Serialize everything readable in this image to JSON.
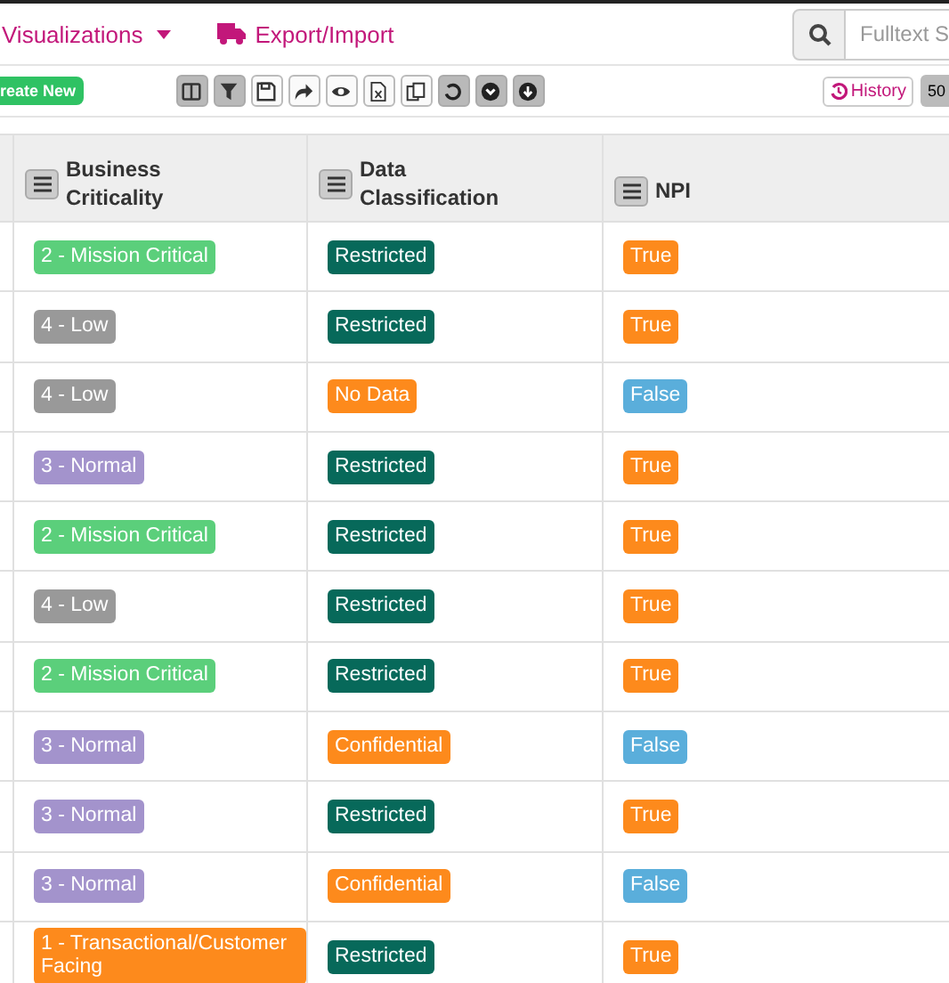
{
  "nav": {
    "visualizations": "Visualizations",
    "export": "Export/Import",
    "search": {
      "placeholder": "Fulltext S"
    }
  },
  "toolbar": {
    "create": "reate New",
    "buttons": [
      {
        "active": true
      },
      {
        "active": true
      },
      {
        "active": false
      },
      {
        "active": false
      },
      {
        "active": false
      },
      {
        "active": false
      },
      {
        "active": false
      },
      {
        "active": true
      },
      {
        "active": true
      },
      {
        "active": true
      }
    ],
    "history": "History",
    "page_size": "50"
  },
  "table": {
    "columns": [
      "Business Criticality",
      "Data Classification",
      "NPI"
    ],
    "rows": [
      [
        {
          "text": "2 - Mission Critical",
          "color": "#5bcf7b"
        },
        {
          "text": "Restricted",
          "color": "#07695a"
        },
        {
          "text": "True",
          "color": "#fd8a1c"
        }
      ],
      [
        {
          "text": "4 - Low",
          "color": "#999999"
        },
        {
          "text": "Restricted",
          "color": "#07695a"
        },
        {
          "text": "True",
          "color": "#fd8a1c"
        }
      ],
      [
        {
          "text": "4 - Low",
          "color": "#999999"
        },
        {
          "text": "No Data",
          "color": "#fd8a1c"
        },
        {
          "text": "False",
          "color": "#5aaedb"
        }
      ],
      [
        {
          "text": "3 - Normal",
          "color": "#a393cc"
        },
        {
          "text": "Restricted",
          "color": "#07695a"
        },
        {
          "text": "True",
          "color": "#fd8a1c"
        }
      ],
      [
        {
          "text": "2 - Mission Critical",
          "color": "#5bcf7b"
        },
        {
          "text": "Restricted",
          "color": "#07695a"
        },
        {
          "text": "True",
          "color": "#fd8a1c"
        }
      ],
      [
        {
          "text": "4 - Low",
          "color": "#999999"
        },
        {
          "text": "Restricted",
          "color": "#07695a"
        },
        {
          "text": "True",
          "color": "#fd8a1c"
        }
      ],
      [
        {
          "text": "2 - Mission Critical",
          "color": "#5bcf7b"
        },
        {
          "text": "Restricted",
          "color": "#07695a"
        },
        {
          "text": "True",
          "color": "#fd8a1c"
        }
      ],
      [
        {
          "text": "3 - Normal",
          "color": "#a393cc"
        },
        {
          "text": "Confidential",
          "color": "#fd8a1c"
        },
        {
          "text": "False",
          "color": "#5aaedb"
        }
      ],
      [
        {
          "text": "3 - Normal",
          "color": "#a393cc"
        },
        {
          "text": "Restricted",
          "color": "#07695a"
        },
        {
          "text": "True",
          "color": "#fd8a1c"
        }
      ],
      [
        {
          "text": "3 - Normal",
          "color": "#a393cc"
        },
        {
          "text": "Confidential",
          "color": "#fd8a1c"
        },
        {
          "text": "False",
          "color": "#5aaedb"
        }
      ],
      [
        {
          "text": "1 - Transactional/Customer Facing",
          "color": "#fd8a1c"
        },
        {
          "text": "Restricted",
          "color": "#07695a"
        },
        {
          "text": "True",
          "color": "#fd8a1c"
        }
      ]
    ]
  }
}
